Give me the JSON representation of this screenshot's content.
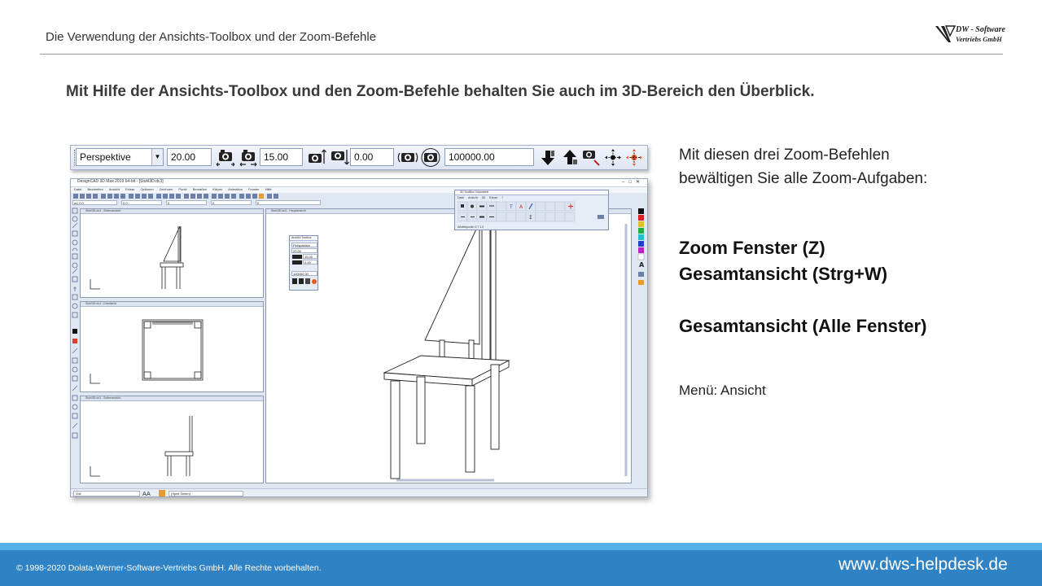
{
  "header": {
    "title": "Die Verwendung der Ansichts-Toolbox und der Zoom-Befehle",
    "logo": {
      "line1": "DW - Software",
      "line2": "Vertriebs GmbH"
    }
  },
  "headline": "Mit Hilfe der Ansichts-Toolbox und den Zoom-Befehle behalten Sie auch im 3D-Bereich den Überblick.",
  "view_toolbar": {
    "projection": "Perspektive",
    "field1": "20.00",
    "field2": "15.00",
    "field3": "0.00",
    "field4": "100000.00",
    "icons": [
      "camera-zoom-in-icon",
      "camera-zoom-out-icon",
      "camera-tilt-up-icon",
      "camera-tilt-down-icon",
      "camera-rotate-left-icon",
      "camera-rotate-right-icon",
      "view-down-icon",
      "view-up-icon",
      "camera-move-icon",
      "pan-icon",
      "pan-zoom-icon"
    ]
  },
  "cad_window": {
    "title": "DesignCAD 3D Max 2019 64-bit - [Stuhl3D.dc3]",
    "menu": [
      "Datei",
      "Bearbeiten",
      "Ansicht",
      "Extras",
      "Optionen",
      "Zeichnen",
      "Punkt",
      "Bemaßen",
      "Körper",
      "Animation",
      "Fenster",
      "Hilfe"
    ],
    "fields": [
      "w1 0.0",
      "0.0",
      "0",
      "0",
      "0"
    ],
    "pane_labels": [
      "Stuhl3D.dc3 - Seitenansicht",
      "Stuhl3D.dc3 - Draufsicht",
      "Stuhl3D.dc3 - Seitenansicht",
      "Stuhl3D.dc3 - Hauptansicht"
    ],
    "mini_toolbox": {
      "title": "Ansicht Toolbox",
      "projection": "Perspektive",
      "values": [
        "20.00",
        "15.00",
        "0.00",
        "100000.00"
      ]
    },
    "toolbar_box": {
      "title": "3D ToolBox Volumetrie",
      "menu": [
        "Datei",
        "Ansicht",
        "3D",
        "Extras",
        "?"
      ],
      "footer": "Arbeitspunkt: 0.7 1.0"
    },
    "status": {
      "line_style": "Voll",
      "font": "(Spell Seiten)"
    }
  },
  "intro": {
    "line1": "Mit diesen drei Zoom-Befehlen",
    "line2": "bewältigen Sie alle Zoom-Aufgaben:"
  },
  "commands": {
    "zoom_window": "Zoom Fenster (Z)",
    "full_view": "Gesamtansicht (Strg+W)",
    "full_view_all": "Gesamtansicht (Alle Fenster)"
  },
  "menu_note": "Menü: Ansicht",
  "footer": {
    "copyright": "© 1998-2020 Dolata-Werner-Software-Vertriebs GmbH. Alle Rechte vorbehalten.",
    "website": "www.dws-helpdesk.de"
  },
  "colors": {
    "footer": "#2f82c4",
    "footer_accent": "#55b0e8"
  }
}
